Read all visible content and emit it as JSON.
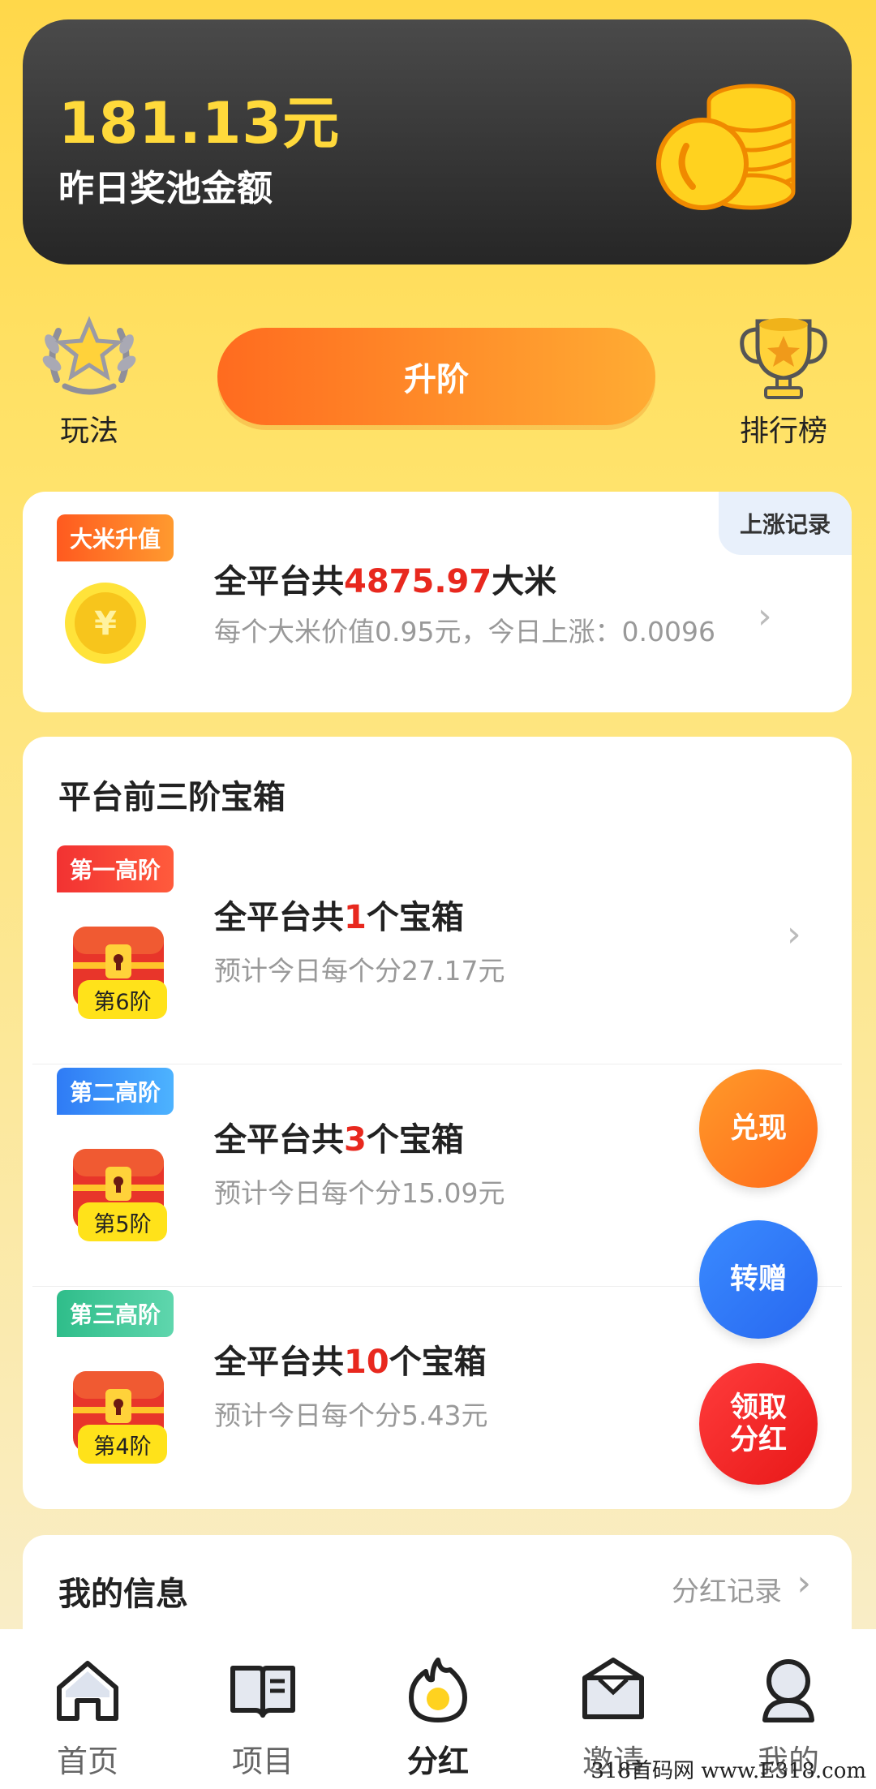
{
  "pool": {
    "amount": "181.13元",
    "label": "昨日奖池金额"
  },
  "actions": {
    "rules_label": "玩法",
    "upgrade_label": "升阶",
    "ranking_label": "排行榜"
  },
  "rice": {
    "tag": "大米升值",
    "rise_record": "上涨记录",
    "total_prefix": "全平台共",
    "total_value": "4875.97",
    "total_suffix": "大米",
    "detail": "每个大米价值0.95元，今日上涨：0.0096"
  },
  "chests": {
    "title": "平台前三阶宝箱",
    "items": [
      {
        "tag": "第一高阶",
        "level": "第6阶",
        "prefix": "全平台共",
        "count": "1",
        "suffix": "个宝箱",
        "detail": "预计今日每个分27.17元"
      },
      {
        "tag": "第二高阶",
        "level": "第5阶",
        "prefix": "全平台共",
        "count": "3",
        "suffix": "个宝箱",
        "detail": "预计今日每个分15.09元"
      },
      {
        "tag": "第三高阶",
        "level": "第4阶",
        "prefix": "全平台共",
        "count": "10",
        "suffix": "个宝箱",
        "detail": "预计今日每个分5.43元"
      }
    ]
  },
  "floating": {
    "exchange": "兑现",
    "gift": "转赠",
    "claim_line1": "领取",
    "claim_line2": "分红"
  },
  "my_info": {
    "title": "我的信息",
    "record_link": "分红记录"
  },
  "tabs": [
    {
      "label": "首页",
      "icon": "home-icon"
    },
    {
      "label": "项目",
      "icon": "book-icon"
    },
    {
      "label": "分红",
      "icon": "flame-icon"
    },
    {
      "label": "邀请",
      "icon": "envelope-icon"
    },
    {
      "label": "我的",
      "icon": "profile-icon"
    }
  ],
  "active_tab": "分红",
  "watermark": "318首码网 www.E318.com",
  "colors": {
    "accent_orange": "#ff6b1f",
    "highlight_red": "#e8281e",
    "gold": "#ffd93b"
  }
}
